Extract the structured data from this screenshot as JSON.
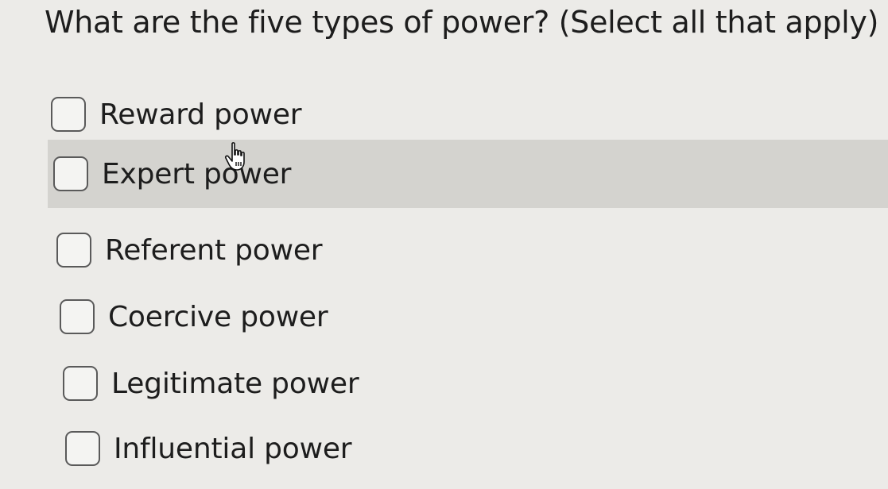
{
  "question": {
    "text": "What are the five types of power? (Select all that apply)"
  },
  "options": [
    {
      "label": "Reward power",
      "checked": false,
      "highlighted": false
    },
    {
      "label": "Expert power",
      "checked": false,
      "highlighted": true
    },
    {
      "label": "Referent power",
      "checked": false,
      "highlighted": false
    },
    {
      "label": "Coercive power",
      "checked": false,
      "highlighted": false
    },
    {
      "label": "Legitimate power",
      "checked": false,
      "highlighted": false
    },
    {
      "label": "Influential power",
      "checked": false,
      "highlighted": false
    }
  ],
  "colors": {
    "background": "#ecebe8",
    "highlight": "#d4d3cf",
    "text": "#1d1d1d",
    "checkbox_border": "#5a5a5a"
  },
  "cursor": {
    "icon": "hand-pointer-icon"
  }
}
